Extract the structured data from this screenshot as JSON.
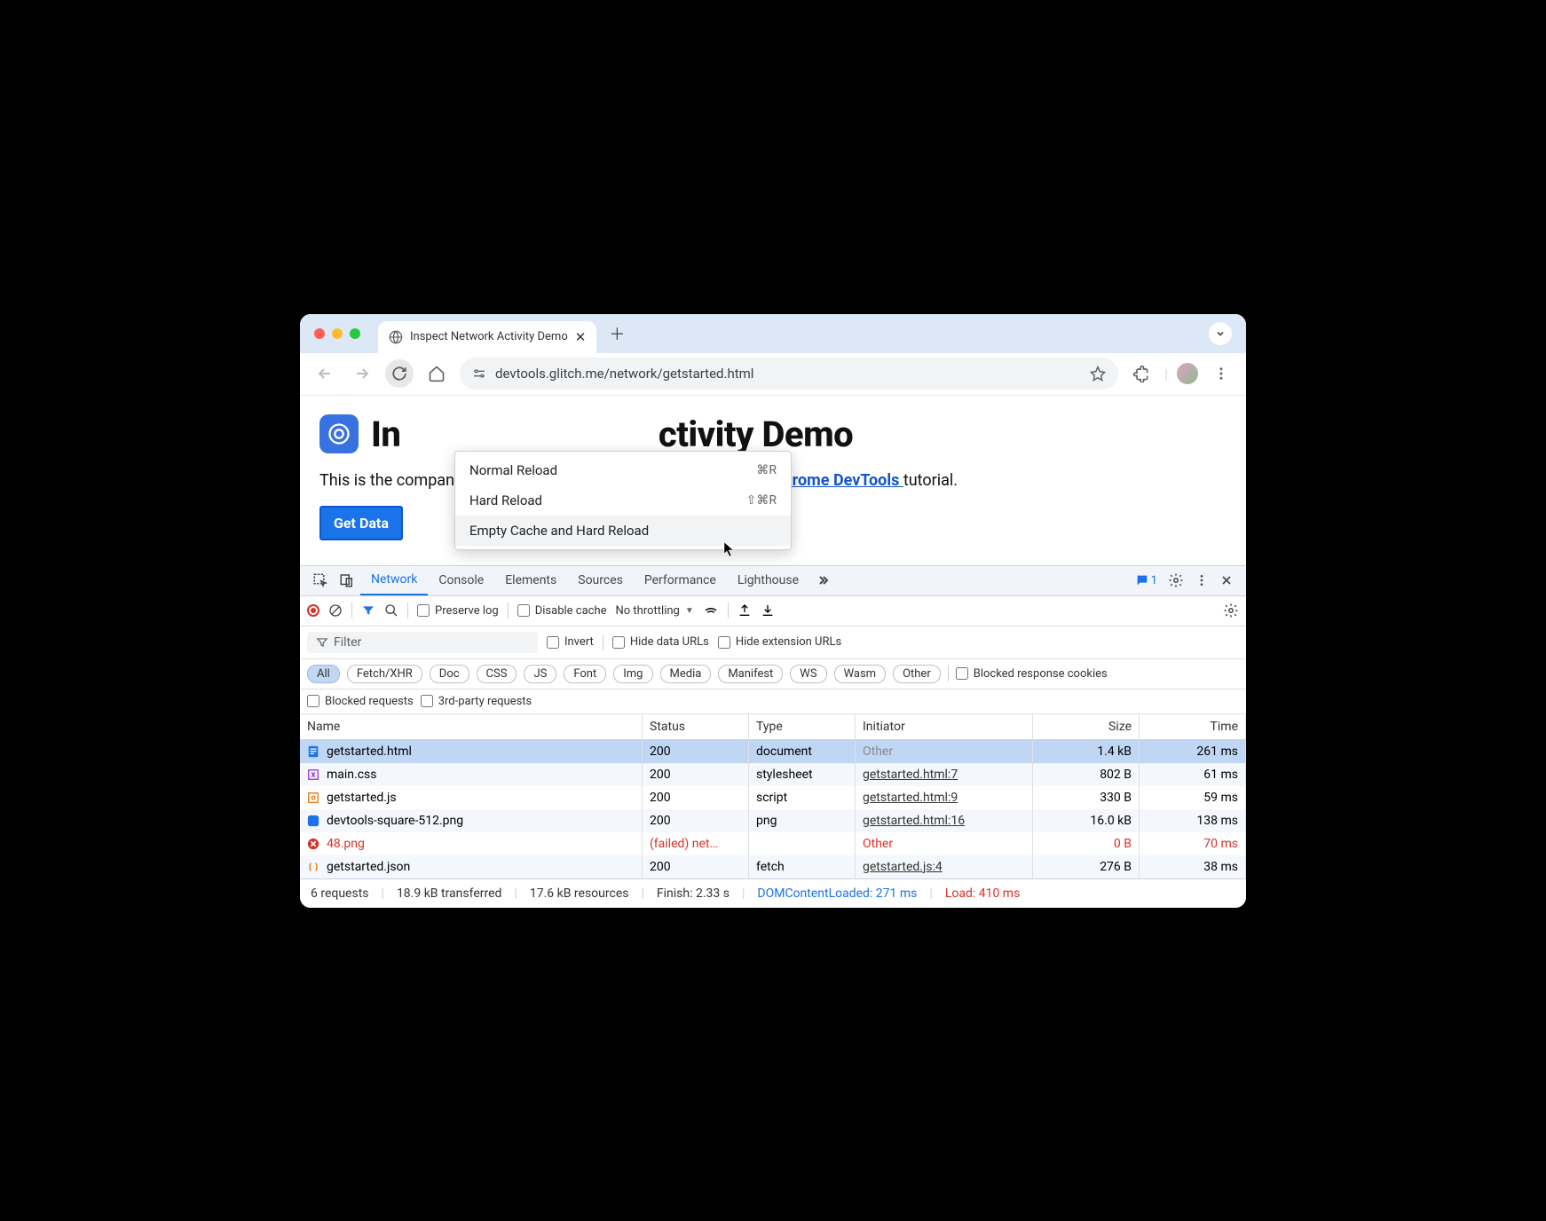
{
  "tab": {
    "title": "Inspect Network Activity Demo"
  },
  "url": "devtools.glitch.me/network/getstarted.html",
  "context_menu": {
    "items": [
      {
        "label": "Normal Reload",
        "shortcut": "⌘R"
      },
      {
        "label": "Hard Reload",
        "shortcut": "⇧⌘R"
      },
      {
        "label": "Empty Cache and Hard Reload",
        "shortcut": ""
      }
    ]
  },
  "page": {
    "title_prefix": "In",
    "title_suffix": "ctivity Demo",
    "subtitle_before": "This is the companion demo for the ",
    "subtitle_link": "Inspect Network Activity In Chrome DevTools ",
    "subtitle_after": "tutorial.",
    "button": "Get Data"
  },
  "devtools": {
    "tabs": [
      "Network",
      "Console",
      "Elements",
      "Sources",
      "Performance",
      "Lighthouse"
    ],
    "active_tab": "Network",
    "chat_count": "1",
    "preserve_log": "Preserve log",
    "disable_cache": "Disable cache",
    "throttling": "No throttling",
    "filter_placeholder": "Filter",
    "invert": "Invert",
    "hide_data": "Hide data URLs",
    "hide_ext": "Hide extension URLs",
    "type_chips": [
      "All",
      "Fetch/XHR",
      "Doc",
      "CSS",
      "JS",
      "Font",
      "Img",
      "Media",
      "Manifest",
      "WS",
      "Wasm",
      "Other"
    ],
    "blocked_cookies": "Blocked response cookies",
    "blocked_requests": "Blocked requests",
    "third_party": "3rd-party requests",
    "headers": {
      "name": "Name",
      "status": "Status",
      "type": "Type",
      "initiator": "Initiator",
      "size": "Size",
      "time": "Time"
    },
    "rows": [
      {
        "icon": "doc-blue",
        "name": "getstarted.html",
        "status": "200",
        "type": "document",
        "initiator": "Other",
        "init_link": false,
        "size": "1.4 kB",
        "time": "261 ms",
        "selected": true
      },
      {
        "icon": "css",
        "name": "main.css",
        "status": "200",
        "type": "stylesheet",
        "initiator": "getstarted.html:7",
        "init_link": true,
        "size": "802 B",
        "time": "61 ms"
      },
      {
        "icon": "js",
        "name": "getstarted.js",
        "status": "200",
        "type": "script",
        "initiator": "getstarted.html:9",
        "init_link": true,
        "size": "330 B",
        "time": "59 ms"
      },
      {
        "icon": "img",
        "name": "devtools-square-512.png",
        "status": "200",
        "type": "png",
        "initiator": "getstarted.html:16",
        "init_link": true,
        "size": "16.0 kB",
        "time": "138 ms"
      },
      {
        "icon": "err",
        "name": "48.png",
        "status": "(failed) net…",
        "type": "",
        "initiator": "Other",
        "init_link": false,
        "size": "0 B",
        "time": "70 ms",
        "error": true
      },
      {
        "icon": "fetch",
        "name": "getstarted.json",
        "status": "200",
        "type": "fetch",
        "initiator": "getstarted.js:4",
        "init_link": true,
        "size": "276 B",
        "time": "38 ms"
      }
    ],
    "status": {
      "requests": "6 requests",
      "transferred": "18.9 kB transferred",
      "resources": "17.6 kB resources",
      "finish": "Finish: 2.33 s",
      "dom": "DOMContentLoaded: 271 ms",
      "load": "Load: 410 ms"
    }
  }
}
